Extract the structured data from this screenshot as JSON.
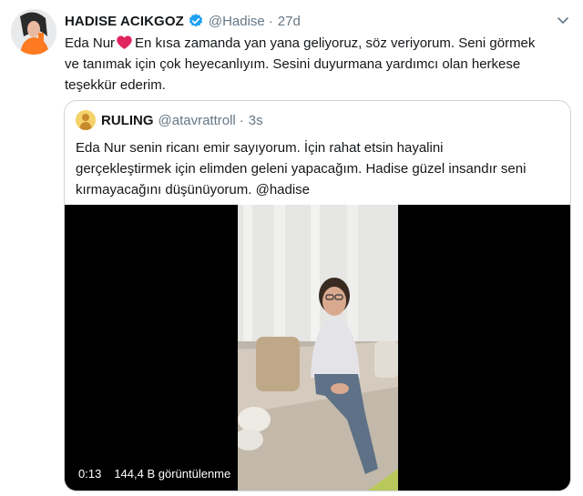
{
  "tweet": {
    "author_name": "HADISE ACIKGOZ",
    "handle": "@Hadise",
    "separator": "·",
    "time": "27d",
    "text_line1_before_heart": "Eda Nur",
    "text_line1_after_heart": "En kısa zamanda yan yana geliyoruz, söz veriyorum. Seni görmek",
    "text_line2": "ve tanımak için çok heyecanlıyım. Sesini duyurmana yardımcı olan herkese",
    "text_line3": "teşekkür ederim."
  },
  "quote": {
    "author_name": "RULING",
    "handle": "@atavrattroll",
    "separator": "·",
    "time": "3s",
    "text_line1": "Eda Nur senin ricanı emir sayıyorum. İçin rahat etsin hayalini",
    "text_line2": "gerçekleştirmek için elimden geleni yapacağım. Hadise güzel insandır seni",
    "text_line3": "kırmayacağını düşünüyorum. @hadise",
    "video": {
      "duration": "0:13",
      "views": "144,4 B görüntülenme"
    }
  },
  "icons": {
    "verified": "verified-badge-icon",
    "heart": "red-heart-emoji",
    "caret": "chevron-down-icon"
  },
  "colors": {
    "verified_blue": "#1da1f2",
    "muted_text": "#657786",
    "border": "#ccd6dd",
    "heart_red": "#e0245e"
  }
}
